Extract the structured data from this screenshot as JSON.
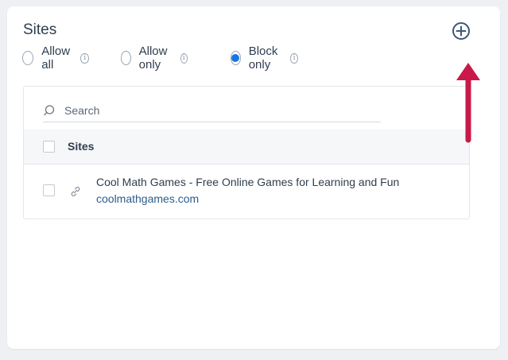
{
  "section": {
    "title": "Sites"
  },
  "radios": [
    {
      "label": "Allow all",
      "checked": false
    },
    {
      "label": "Allow only",
      "checked": false
    },
    {
      "label": "Block only",
      "checked": true
    }
  ],
  "info_glyph": "i",
  "search": {
    "placeholder": "Search"
  },
  "table": {
    "column_header": "Sites",
    "rows": [
      {
        "title": "Cool Math Games - Free Online Games for Learning and Fun",
        "url": "coolmathgames.com"
      }
    ]
  },
  "colors": {
    "accent": "#1b74e4",
    "annotation_arrow": "#c8194a",
    "link": "#2c5c8c",
    "text": "#2f3e4e"
  },
  "icons": {
    "add": "plus-circle-icon",
    "search": "search-icon",
    "link": "link-icon",
    "info": "info-icon"
  }
}
